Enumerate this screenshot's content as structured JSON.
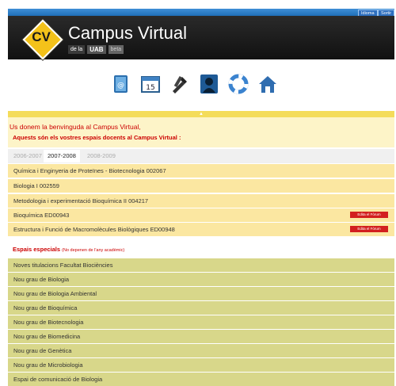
{
  "topbar": {
    "idioma_label": "Idioma",
    "sortir_label": "Sortir"
  },
  "brand": {
    "logo_text": "CV",
    "title": "Campus Virtual",
    "sub_prefix": "de la",
    "sub_uab": "UAB",
    "sub_tag": "beta"
  },
  "toolbar": {
    "icons": [
      "agenda-icon",
      "calendar-icon",
      "tools-icon",
      "profile-icon",
      "help-ring-icon",
      "home-icon"
    ]
  },
  "welcome": {
    "line1": "Us donem la benvinguda al Campus Virtual,",
    "line2": "Aquests són els vostres espais docents al Campus Virtual :"
  },
  "years": [
    "2006-2007",
    "2007-2008",
    "2008-2009"
  ],
  "active_year": "2007-2008",
  "courses": [
    {
      "name": "Química i Enginyeria de Proteïnes - Biotecnologia 002067"
    },
    {
      "name": "Biologia I 002559"
    },
    {
      "name": "Metodologia i experimentació Bioquímica II 004217"
    },
    {
      "name": "Bioquímica ED00943",
      "badge": "Edita el Fòrum"
    },
    {
      "name": "Estructura i Funció de Macromolècules Biològiques ED00948",
      "badge": "Edita el Fòrum"
    }
  ],
  "special": {
    "title": "Espais especials",
    "note": "(No depenen de l'any acadèmic)",
    "items": [
      "Noves titulacions Facultat Biociències",
      "Nou grau de Biologia",
      "Nou grau de Biologia Ambiental",
      "Nou grau de Bioquímica",
      "Nou grau de Biotecnologia",
      "Nou grau de Biomedicina",
      "Nou grau de Genètica",
      "Nou grau de Microbiologia",
      "Espai de comunicació de Biologia"
    ]
  },
  "colors": {
    "accent_red": "#cc0000",
    "row_yellow": "#fbe7a1",
    "row_green": "#d8d78a",
    "header_bg": "#111111"
  }
}
